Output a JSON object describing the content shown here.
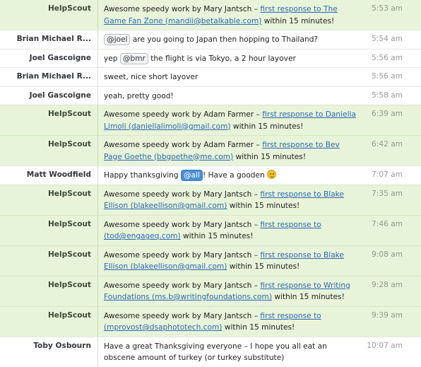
{
  "messages": [
    {
      "author": "HelpScout",
      "time": "5:53 am",
      "type": "bot",
      "prefix": "Awesome speedy work by Mary Jantsch – ",
      "link": "first response to The Game Fan Zone (mandii@betalkable.com)",
      "suffix": " within 15 minutes!"
    },
    {
      "author": "Brian Michael R...",
      "time": "5:54 am",
      "type": "user",
      "mention": "@joel",
      "text": " are you going to Japan then hopping to Thailand?"
    },
    {
      "author": "Joel Gascoigne",
      "time": "5:56 am",
      "type": "user",
      "pre": "yep ",
      "mention": "@bmr",
      "text": " the flight is via Tokyo, a 2 hour layover"
    },
    {
      "author": "Brian Michael R...",
      "time": "5:56 am",
      "type": "user",
      "text": "sweet, nice short layover"
    },
    {
      "author": "Joel Gascoigne",
      "time": "5:58 am",
      "type": "user",
      "text": "yeah, pretty good!"
    },
    {
      "author": "HelpScout",
      "time": "6:39 am",
      "type": "bot",
      "prefix": "Awesome speedy work by Adam Farmer – ",
      "link": "first response to Daniella Limoli (daniellalimoli@gmail.com)",
      "suffix": " within 15 minutes!"
    },
    {
      "author": "HelpScout",
      "time": "6:42 am",
      "type": "bot",
      "prefix": "Awesome speedy work by Adam Farmer – ",
      "link": "first response to Bev Page Goethe (bbgoethe@me.com)",
      "suffix": " within 15 minutes!"
    },
    {
      "author": "Matt Woodfield",
      "time": "7:07 am",
      "type": "user",
      "pre": "Happy thanksgiving ",
      "mention": "@all",
      "text": "! Have a gooden ",
      "emoji": "smiley-emoji"
    },
    {
      "author": "HelpScout",
      "time": "7:35 am",
      "type": "bot",
      "prefix": "Awesome speedy work by Mary Jantsch – ",
      "link": "first response to Blake Ellison (blakeellison@gmail.com)",
      "suffix": " within 15 minutes!"
    },
    {
      "author": "HelpScout",
      "time": "7:46 am",
      "type": "bot",
      "prefix": "Awesome speedy work by Mary Jantsch – ",
      "link": "first response to (tod@engageq.com)",
      "suffix": " within 15 minutes!"
    },
    {
      "author": "HelpScout",
      "time": "9:08 am",
      "type": "bot",
      "prefix": "Awesome speedy work by Mary Jantsch – ",
      "link": "first response to Blake Ellison (blakeellison@gmail.com)",
      "suffix": " within 15 minutes!"
    },
    {
      "author": "HelpScout",
      "time": "9:28 am",
      "type": "bot",
      "prefix": "Awesome speedy work by Mary Jantsch – ",
      "link": "first response to Writing Foundations (ms.b@writingfoundations.com)",
      "suffix": " within 15 minutes!"
    },
    {
      "author": "HelpScout",
      "time": "9:39 am",
      "type": "bot",
      "prefix": "Awesome speedy work by Mary Jantsch – ",
      "link": "first response to (mprovost@dsaphototech.com)",
      "suffix": " within 15 minutes!"
    },
    {
      "author": "Toby Osbourn",
      "time": "10:07 am",
      "type": "user",
      "text": "Have a great Thanksgiving everyone – I hope you all eat an obscene amount of turkey (or turkey substitute)"
    }
  ],
  "colors": {
    "bot_row_bg": "#e7f4d9",
    "link": "#2d67b3",
    "mention_highlight": "#4a8fd3"
  }
}
